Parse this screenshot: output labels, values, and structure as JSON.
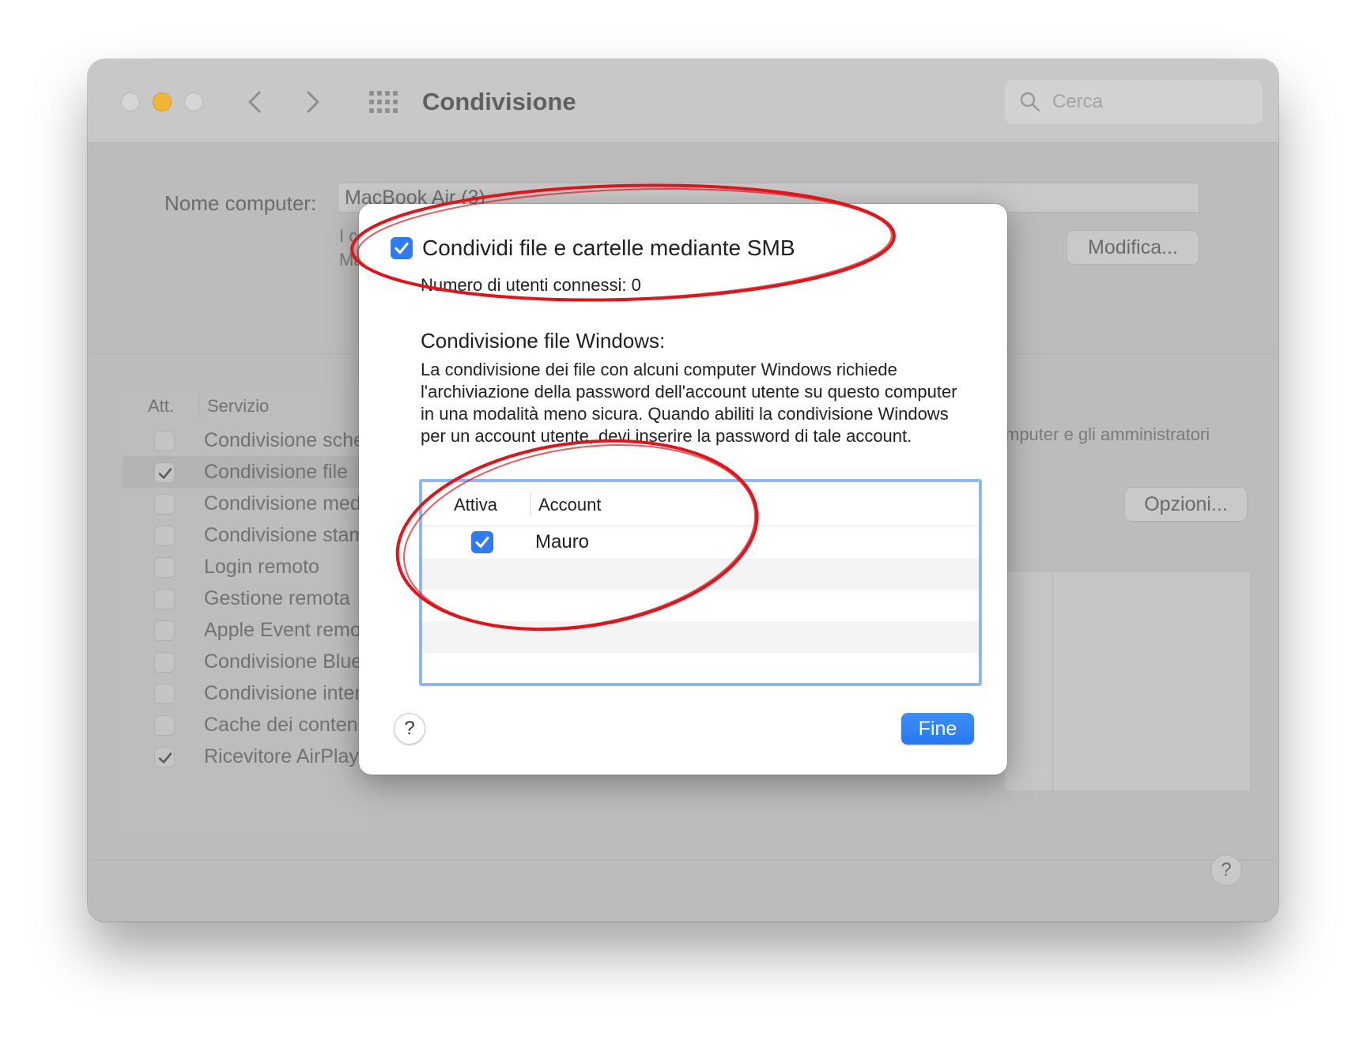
{
  "window": {
    "title": "Condivisione",
    "search_placeholder": "Cerca"
  },
  "computer": {
    "name_label": "Nome computer:",
    "name_value": "MacBook Air (3)",
    "subtext_line1": "I co",
    "subtext_line2": "Ma",
    "modify_button": "Modifica..."
  },
  "services": {
    "header_att": "Att.",
    "header_service": "Servizio",
    "items": [
      {
        "label": "Condivisione schermo",
        "checked": false
      },
      {
        "label": "Condivisione file",
        "checked": true,
        "selected": true
      },
      {
        "label": "Condivisione media",
        "checked": false
      },
      {
        "label": "Condivisione stampante",
        "checked": false
      },
      {
        "label": "Login remoto",
        "checked": false
      },
      {
        "label": "Gestione remota",
        "checked": false
      },
      {
        "label": "Apple Event remoti",
        "checked": false
      },
      {
        "label": "Condivisione Bluetooth",
        "checked": false
      },
      {
        "label": "Condivisione internet",
        "checked": false
      },
      {
        "label": "Cache dei contenuti",
        "checked": false
      },
      {
        "label": "Ricevitore AirPlay",
        "checked": true
      }
    ]
  },
  "right_panel": {
    "text": "mputer e gli amministratori",
    "options_button": "Opzioni..."
  },
  "sheet": {
    "smb_checkbox_label": "Condividi file e cartelle mediante SMB",
    "smb_checked": true,
    "connected_users": "Numero di utenti connessi: 0",
    "windows_heading": "Condivisione file Windows:",
    "windows_description": "La condivisione dei file con alcuni computer Windows richiede l'archiviazione della password dell'account utente su questo computer in una modalità meno sicura. Quando abiliti la condivisione Windows per un account utente, devi inserire la password di tale account.",
    "table": {
      "col_active": "Attiva",
      "col_account": "Account",
      "rows": [
        {
          "account": "Mauro",
          "active": true
        }
      ]
    },
    "help_label": "?",
    "done_button": "Fine"
  },
  "help_label": "?",
  "colors": {
    "accent": "#2f7bf5",
    "annotation": "#e0141a",
    "minimize": "#f0b534"
  },
  "icons": [
    "close-button",
    "minimize-button",
    "zoom-button",
    "chevron-left-icon",
    "chevron-right-icon",
    "grid-icon",
    "search-icon",
    "checkmark-icon",
    "help-icon"
  ]
}
